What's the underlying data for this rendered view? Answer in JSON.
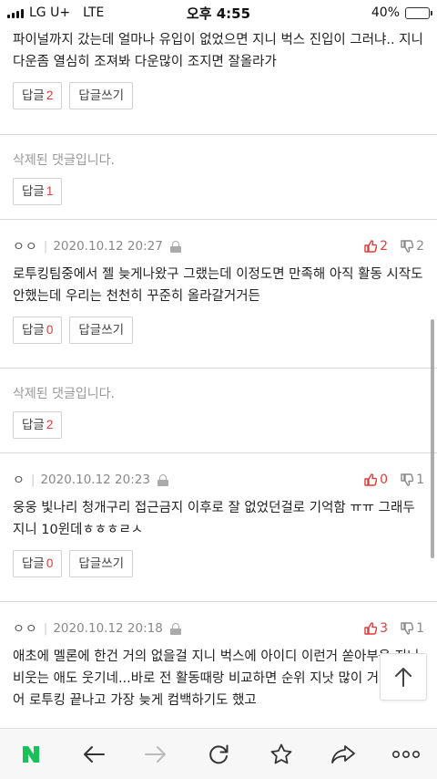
{
  "status_bar": {
    "carrier": "LG U+",
    "network": "LTE",
    "time": "오후 4:55",
    "battery": "40%",
    "battery_level": 0.4,
    "battery_color": "#f2c22f"
  },
  "comments": [
    {
      "text": "파이널까지 갔는데 얼마나 유입이 없었으면 지니 벅스 진입이 그러냐.. 지니 다운좀 열심히 조져봐 다운많이 조지면 잘올라가",
      "reply_label": "답글",
      "reply_count": "2",
      "write_label": "답글쓰기"
    },
    {
      "deleted_text": "삭제된 댓글입니다.",
      "reply_label": "답글",
      "reply_count": "1"
    },
    {
      "author": "ㅇㅇ",
      "date": "2020.10.12 20:27",
      "likes": "2",
      "dislikes": "2",
      "text": "로투킹팀중에서 젤 늦게나왔구 그랬는데 이정도면 만족해 아직 활동 시작도안했는데 우리는 천천히 꾸준히 올라갈거거든",
      "reply_label": "답글",
      "reply_count": "0",
      "write_label": "답글쓰기"
    },
    {
      "deleted_text": "삭제된 댓글입니다.",
      "reply_label": "답글",
      "reply_count": "2"
    },
    {
      "author": "ㅇ",
      "date": "2020.10.12 20:23",
      "likes": "0",
      "dislikes": "1",
      "text": "웅웅 빛나리 청개구리 접근금지 이후로 잘 없었던걸로 기억함 ㅠㅠ 그래두 지니 10윈데ㅎㅎㅎㄹㅅ",
      "reply_label": "답글",
      "reply_count": "0",
      "write_label": "답글쓰기"
    },
    {
      "author": "ㅇㅇ",
      "date": "2020.10.12 20:18",
      "likes": "3",
      "dislikes": "1",
      "text": "애초에 멜론에 한건 거의 없을걸 지니 벅스에 아이디 이런거 쏟아부음 지니 비웃는 애도 웃기네...바로 전 활동때랑 비교하면 순위 지낫 많이 거임 심지어 로투킹 끝나고 가장 늦게 컴백하기도 했고"
    }
  ],
  "toolbar": {
    "home_icon": "naver-n-logo",
    "back_icon": "arrow-left-icon",
    "forward_icon": "arrow-right-icon",
    "refresh_icon": "refresh-icon",
    "bookmark_icon": "star-icon",
    "share_icon": "share-icon",
    "more_icon": "more-icon"
  },
  "colors": {
    "accent_red": "#e03b3b",
    "naver_green": "#19c15b"
  }
}
